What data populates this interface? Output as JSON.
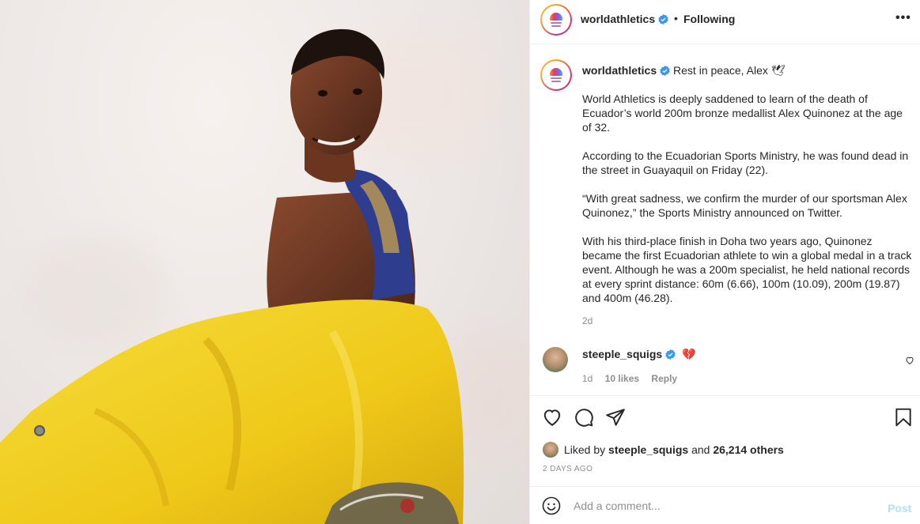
{
  "header": {
    "username": "worldathletics",
    "separator": "•",
    "follow_label": "Following",
    "more_label": "•••"
  },
  "caption": {
    "username": "worldathletics",
    "title": "Rest in peace, Alex 🕊",
    "paragraphs": [
      "World Athletics is deeply saddened to learn of the death of Ecuador’s world 200m bronze medallist Alex Quinonez at the age of 32.",
      "According to the Ecuadorian Sports Ministry, he was found dead in the street in Guayaquil on Friday (22).",
      "“With great sadness, we confirm the murder of our sportsman Alex Quinonez,” the Sports Ministry announced on Twitter.",
      "With his third-place finish in Doha two years ago, Quinonez became the first Ecuadorian athlete to win a global medal in a track event. Although he was a 200m specialist, he held national records at every sprint distance: 60m (6.66), 100m (10.09), 200m (19.87) and 400m (46.28)."
    ],
    "time": "2d"
  },
  "comment": {
    "username": "steeple_squigs",
    "text": "💔",
    "time": "1d",
    "likes": "10 likes",
    "reply_label": "Reply"
  },
  "actions": {
    "liked_prefix": "Liked by",
    "liked_user": "steeple_squigs",
    "liked_and": "and",
    "liked_others": "26,214 others",
    "date": "2 DAYS AGO"
  },
  "add_comment": {
    "placeholder": "Add a comment...",
    "post_label": "Post"
  },
  "colors": {
    "verified": "#3897f0",
    "link_disabled": "#b2dffc",
    "muted": "#8e8e8e",
    "flag_yellow": "#f3d11c"
  }
}
